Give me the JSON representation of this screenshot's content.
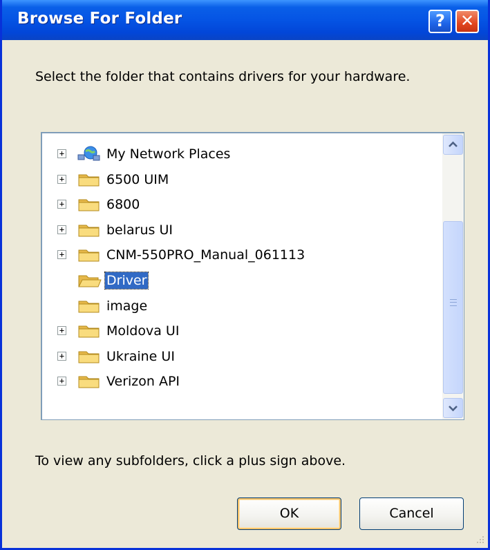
{
  "window": {
    "title": "Browse For Folder",
    "help_label": "?",
    "close_label": "✕"
  },
  "instruction": "Select the folder that contains drivers for your hardware.",
  "tree": {
    "items": [
      {
        "label": "My Network Places",
        "icon": "network-places-icon",
        "expandable": true,
        "selected": false
      },
      {
        "label": "6500 UIM",
        "icon": "folder-icon",
        "expandable": true,
        "selected": false
      },
      {
        "label": "6800",
        "icon": "folder-icon",
        "expandable": true,
        "selected": false
      },
      {
        "label": "belarus UI",
        "icon": "folder-icon",
        "expandable": true,
        "selected": false
      },
      {
        "label": "CNM-550PRO_Manual_061113",
        "icon": "folder-icon",
        "expandable": true,
        "selected": false
      },
      {
        "label": "Driver",
        "icon": "open-folder-icon",
        "expandable": false,
        "selected": true
      },
      {
        "label": "image",
        "icon": "folder-icon",
        "expandable": false,
        "selected": false
      },
      {
        "label": "Moldova UI",
        "icon": "folder-icon",
        "expandable": true,
        "selected": false
      },
      {
        "label": "Ukraine UI",
        "icon": "folder-icon",
        "expandable": true,
        "selected": false
      },
      {
        "label": "Verizon API",
        "icon": "folder-icon",
        "expandable": true,
        "selected": false
      }
    ],
    "expand_glyph": "+"
  },
  "hint": "To view any subfolders, click a plus sign above.",
  "buttons": {
    "ok_label": "OK",
    "cancel_label": "Cancel"
  },
  "colors": {
    "titlebar": "#0554e4",
    "selection": "#316ac5",
    "window_bg": "#ece9d8",
    "folder": "#f5d36b"
  }
}
